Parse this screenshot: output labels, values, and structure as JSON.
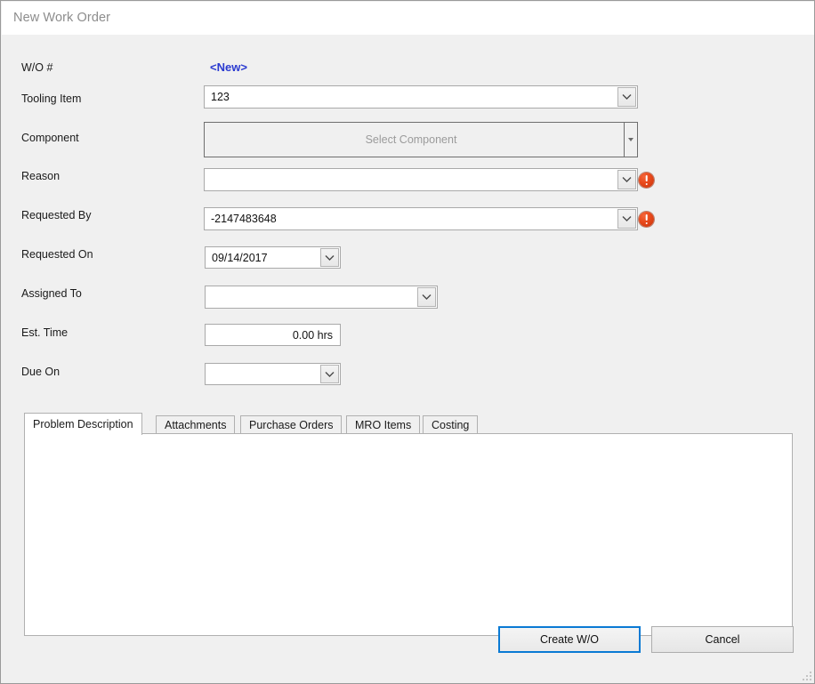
{
  "window": {
    "title": "New Work Order"
  },
  "form": {
    "fields": [
      {
        "label": "W/O #",
        "value": "<New>"
      },
      {
        "label": "Tooling Item",
        "value": "123"
      },
      {
        "label": "Component",
        "placeholder": "Select Component"
      },
      {
        "label": "Reason",
        "value": ""
      },
      {
        "label": "Requested By",
        "value": "-2147483648"
      },
      {
        "label": "Requested On",
        "value": "09/14/2017"
      },
      {
        "label": "Assigned To",
        "value": ""
      },
      {
        "label": "Est. Time",
        "value": "0.00 hrs"
      },
      {
        "label": "Due On",
        "value": ""
      }
    ]
  },
  "validation": {
    "reason_error_icon": "error-icon",
    "requested_by_error_icon": "error-icon"
  },
  "tabs": [
    {
      "label": "Problem Description",
      "active": true
    },
    {
      "label": "Attachments",
      "active": false
    },
    {
      "label": "Purchase Orders",
      "active": false
    },
    {
      "label": "MRO Items",
      "active": false
    },
    {
      "label": "Costing",
      "active": false
    }
  ],
  "problem_description": {
    "value": ""
  },
  "buttons": {
    "create": "Create W/O",
    "cancel": "Cancel"
  },
  "colors": {
    "accent_link": "#2a3ad0",
    "focus_border": "#0a7ad4",
    "error": "#e8491b",
    "window_background": "#f0f0f0"
  }
}
